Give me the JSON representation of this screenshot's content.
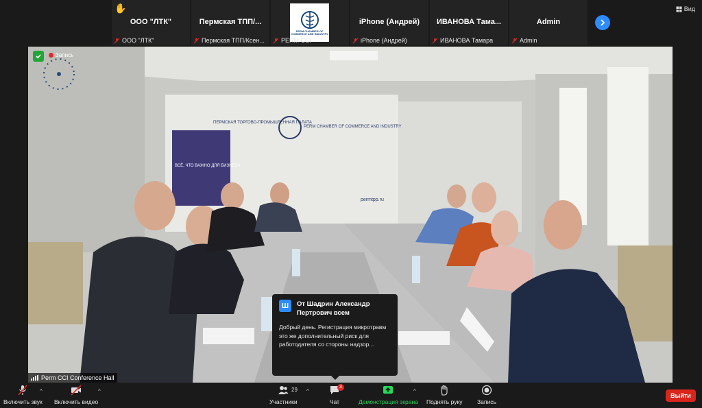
{
  "participants": [
    {
      "name": "ООО \"ЛТК\"",
      "footer": "ООО \"ЛТК\"",
      "hand": true
    },
    {
      "name": "Пермская  ТПП/...",
      "footer": "Пермская ТПП/Ксен..."
    },
    {
      "name": "",
      "footer": "PERM CCI",
      "logo_text": "PERM CHAMBER OF COMMERCE AND INDUSTRY"
    },
    {
      "name": "iPhone (Андрей)",
      "footer": "iPhone (Андрей)"
    },
    {
      "name": "ИВАНОВА Тама...",
      "footer": "ИВАНОВА Тамара"
    },
    {
      "name": "Admin",
      "footer": "Admin"
    }
  ],
  "view_label": "Вид",
  "video": {
    "recording_label": "Запись",
    "speaker_label": "Perm CCI Conference Hall",
    "wall_text_ru": "ПЕРМСКАЯ ТОРГОВО-ПРОМЫШЛЕННАЯ ПАЛАТА",
    "wall_text_en": "PERM CHAMBER OF COMMERCE AND INDUSTRY",
    "wall_url": "permtpp.ru",
    "banner_text": "ВСЁ, ЧТО ВАЖНО ДЛЯ БИЗНЕСА"
  },
  "chat_popup": {
    "avatar": "Ш",
    "from": "От Шадрин Александр Пертрович всем",
    "message": "Добрый день. Регистрация микротравм это же дополнительный риск для работодателя со стороны надзор..."
  },
  "toolbar": {
    "mute": "Включить звук",
    "video": "Включить видео",
    "participants": "Участники",
    "participants_count": "29",
    "chat": "Чат",
    "chat_badge": "3",
    "share": "Демонстрация экрана",
    "raise_hand": "Поднять руку",
    "record": "Запись",
    "leave": "Выйти"
  },
  "colors": {
    "accent": "#2d8cff",
    "share_green": "#23d959",
    "leave_red": "#d9251c",
    "mic_off_red": "#e02828"
  }
}
